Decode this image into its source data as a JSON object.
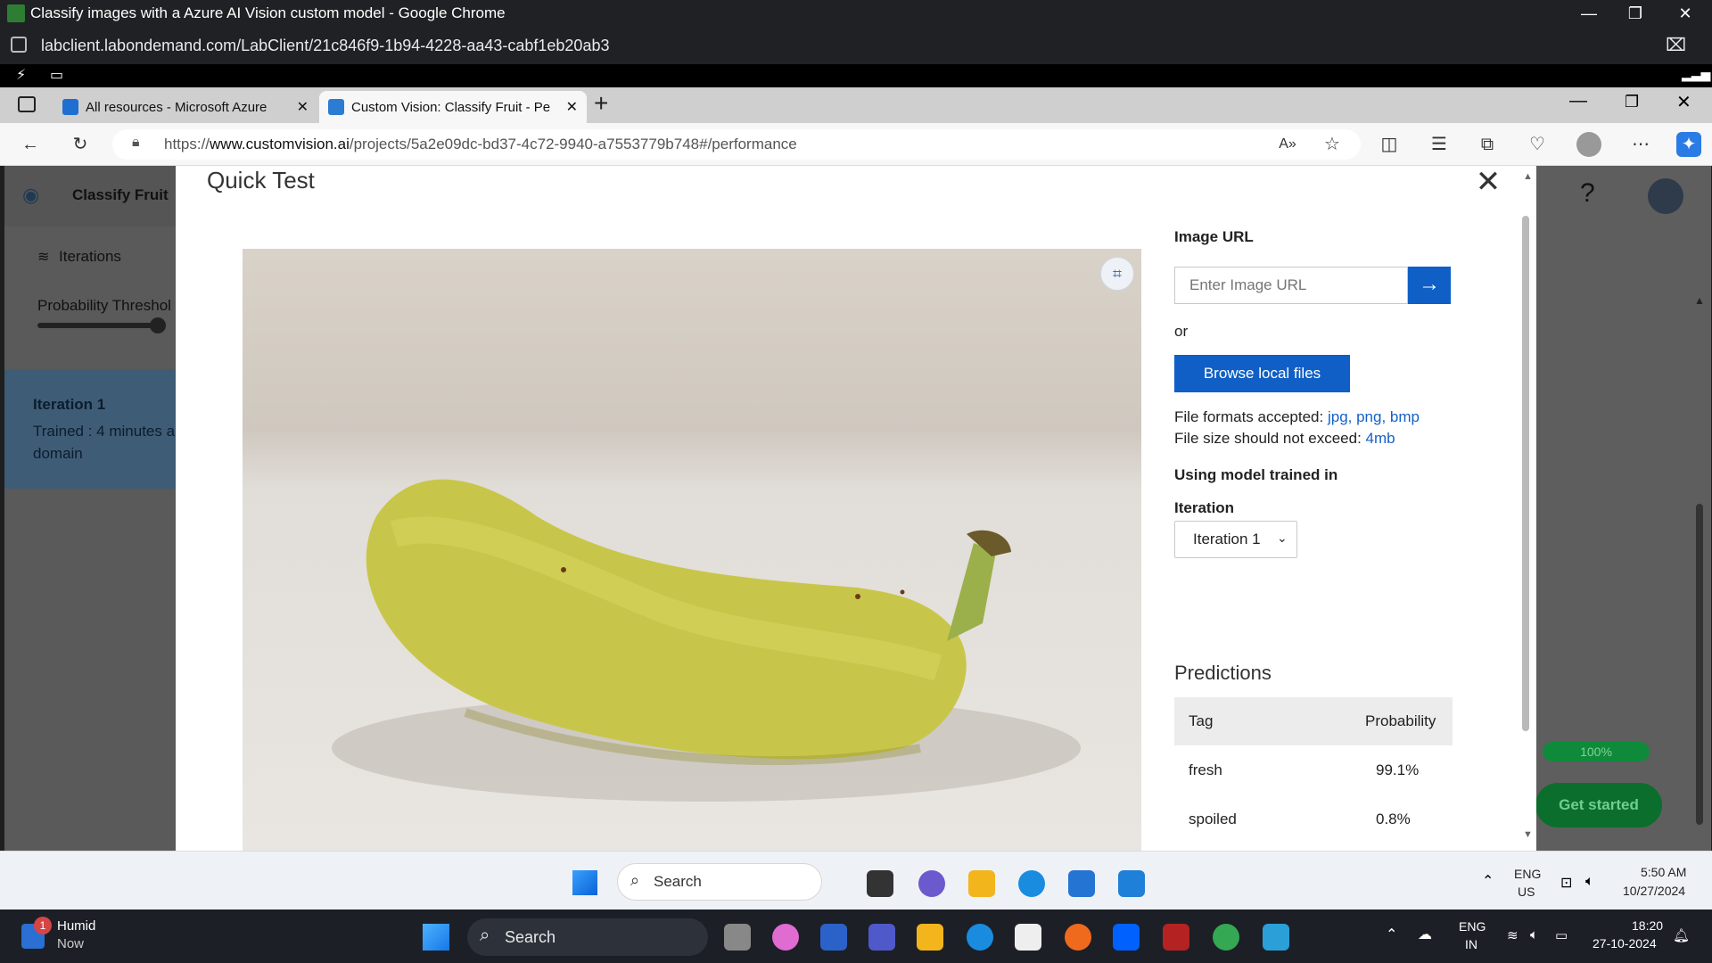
{
  "outer_window": {
    "title": "Classify images with a Azure AI Vision custom model - Google Chrome",
    "url": "labclient.labondemand.com/LabClient/21c846f9-1b94-4228-aa43-cabf1eb20ab3"
  },
  "edge": {
    "tabs": [
      {
        "label": "All resources - Microsoft Azure",
        "active": false
      },
      {
        "label": "Custom Vision: Classify Fruit - Pe",
        "active": true
      }
    ],
    "new_tab": "+",
    "address_prefix": "https://",
    "address_host": "www.customvision.ai",
    "address_path": "/projects/5a2e09dc-bd37-4c72-9940-a7553779b748#/performance"
  },
  "page": {
    "project_name": "Classify Fruit",
    "iterations_label": "Iterations",
    "probability_threshold_label": "Probability Threshol",
    "iteration_card": {
      "title": "Iteration 1",
      "trained": "Trained : 4 minutes a",
      "domain": "domain"
    },
    "help": "?",
    "percent": "100%",
    "get_started": "Get started"
  },
  "quick_test": {
    "title": "Quick Test",
    "close": "✕",
    "image_url_label": "Image URL",
    "image_url_placeholder": "Enter Image URL",
    "go": "→",
    "or": "or",
    "browse": "Browse local files",
    "formats_prefix": "File formats accepted: ",
    "formats": "jpg, png, bmp",
    "size_prefix": "File size should not exceed: ",
    "size": "4mb",
    "model_label": "Using model trained in",
    "iteration_label": "Iteration",
    "iteration_value": "Iteration 1",
    "predictions_title": "Predictions",
    "columns": [
      "Tag",
      "Probability"
    ],
    "predictions": [
      {
        "tag": "fresh",
        "probability": "99.1%"
      },
      {
        "tag": "spoiled",
        "probability": "0.8%"
      }
    ]
  },
  "taskbar_inner": {
    "search": "Search",
    "lang_top": "ENG",
    "lang_bottom": "US",
    "time": "5:50 AM",
    "date": "10/27/2024"
  },
  "taskbar_outer": {
    "weather_title": "Humid",
    "weather_sub": "Now",
    "badge": "1",
    "search": "Search",
    "lang_top": "ENG",
    "lang_bottom": "IN",
    "time": "18:20",
    "date": "27-10-2024"
  }
}
